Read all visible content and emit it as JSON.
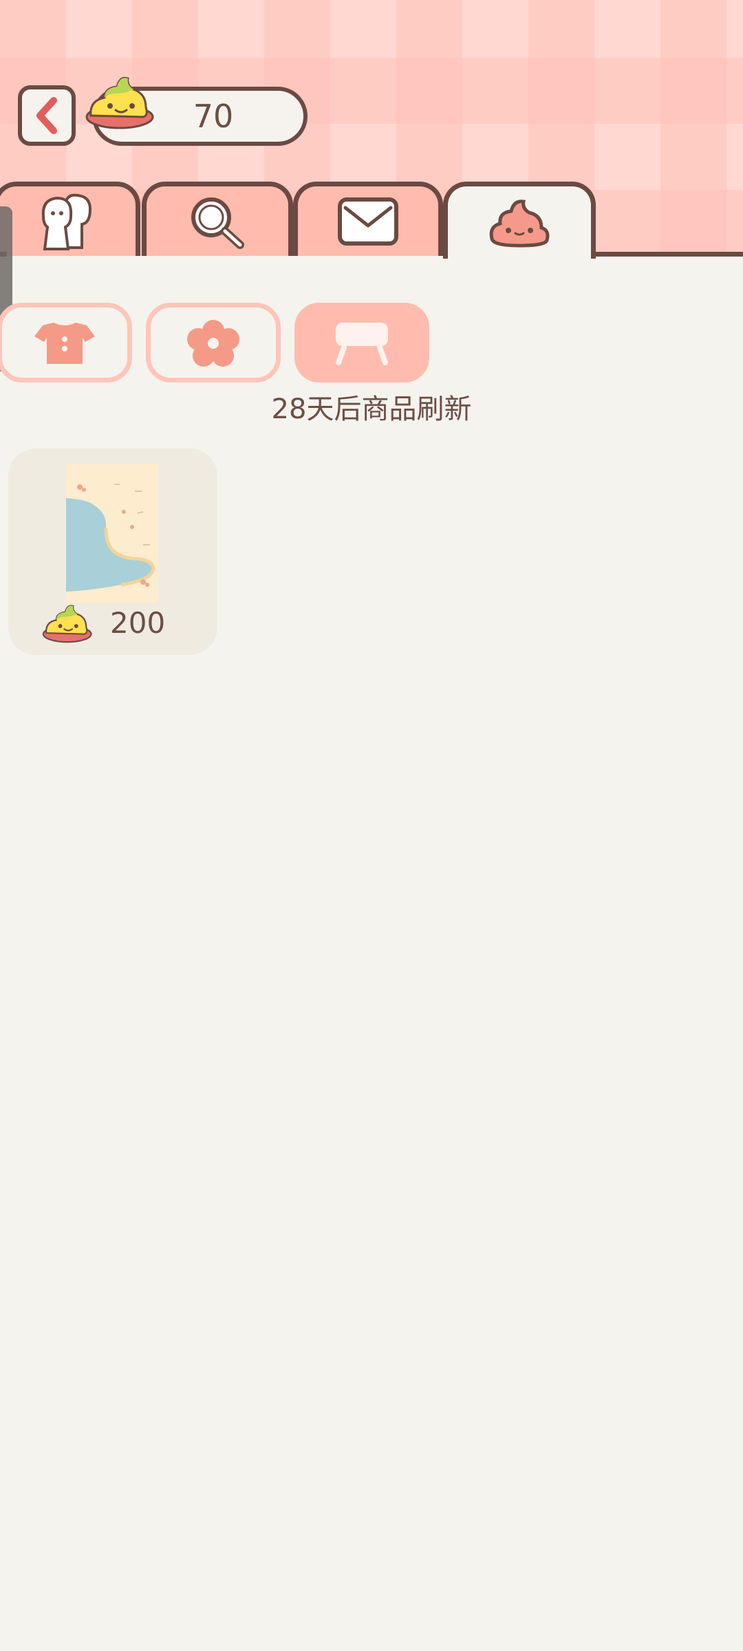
{
  "header": {
    "coin_balance": "70"
  },
  "tabs": [
    {
      "icon": "friends-icon",
      "active": false
    },
    {
      "icon": "search-icon",
      "active": false
    },
    {
      "icon": "mail-icon",
      "active": false
    },
    {
      "icon": "poop-shop-icon",
      "active": true
    }
  ],
  "categories": [
    {
      "icon": "shirt-icon",
      "active": false
    },
    {
      "icon": "flower-icon",
      "active": false
    },
    {
      "icon": "furniture-table-icon",
      "active": true
    }
  ],
  "shop": {
    "refresh_notice": "28天后商品刷新",
    "items": [
      {
        "image": "beach-wallpaper",
        "price": "200",
        "currency_icon": "poop-coin-icon"
      }
    ]
  },
  "colors": {
    "background": "#f5f3ee",
    "header_pink": "#ffd8d2",
    "outline_brown": "#6b4a42",
    "tab_salmon": "#ffbcae",
    "accent_coral": "#f59a86"
  }
}
